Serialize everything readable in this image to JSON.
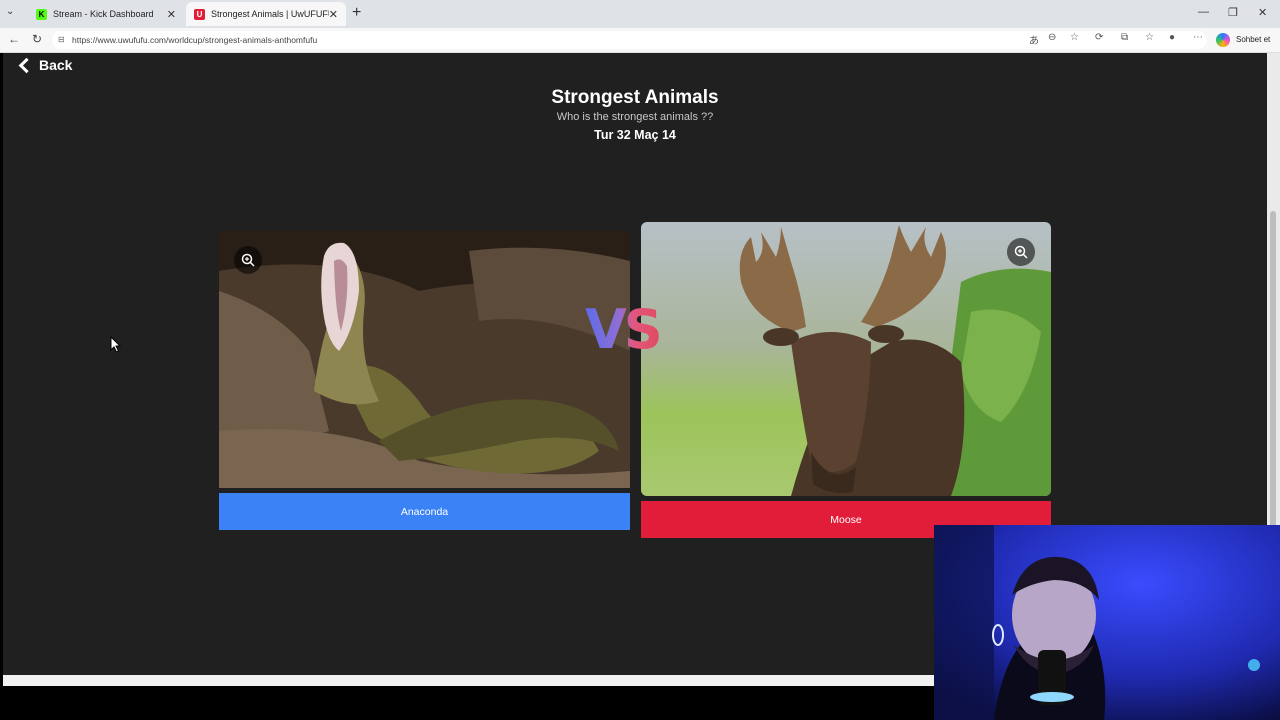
{
  "browser": {
    "tabs": [
      {
        "title": "Stream - Kick Dashboard",
        "favicon": "K"
      },
      {
        "title": "Strongest Animals | UwUFUFU",
        "favicon": "U"
      }
    ],
    "url": "https://www.uwufufu.com/worldcup/strongest-animals-anthomfufu",
    "copilot_label": "Sohbet et"
  },
  "page": {
    "back_label": "Back",
    "title": "Strongest Animals",
    "subtitle": "Who is the strongest animals ??",
    "round": "Tur 32 Maç 14",
    "vs": "VS",
    "left": {
      "name": "Anaconda",
      "button_color": "#3b82f6"
    },
    "right": {
      "name": "Moose",
      "button_color": "#e11d3a"
    }
  },
  "colors": {
    "page_bg": "#202020",
    "tab_bar": "#dfe3e8"
  }
}
